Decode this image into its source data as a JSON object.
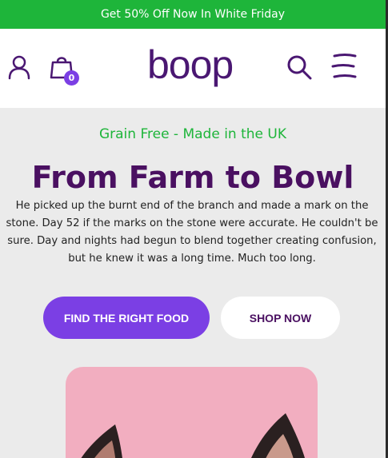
{
  "promo": {
    "text": "Get 50% Off Now In White Friday"
  },
  "header": {
    "logo": "boop",
    "cart_count": "0",
    "icons": [
      "user-icon",
      "cart-icon",
      "search-icon",
      "menu-icon"
    ]
  },
  "hero": {
    "tagline": "Grain Free - Made in the UK",
    "headline": "From Farm to Bowl",
    "body": "He picked up the burnt end of the branch and made a mark on the stone. Day 52 if the marks on the stone were accurate. He couldn't be sure. Day and nights had begun to blend together creating confusion, but he knew it was a long time. Much too long.",
    "primary_button": "FIND THE RIGHT FOOD",
    "secondary_button": "SHOP NOW"
  },
  "colors": {
    "promo_bg": "#1eb53a",
    "brand_purple": "#4a1772",
    "accent_purple": "#7b3fe4",
    "tagline_green": "#1eb53a",
    "page_bg": "#ebebeb",
    "image_bg": "#f2aec0"
  }
}
